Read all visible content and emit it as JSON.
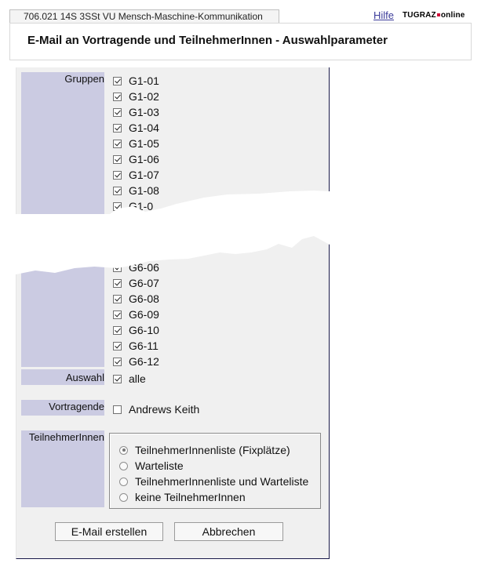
{
  "header": {
    "course": "706.021 14S 3SSt VU Mensch-Maschine-Kommunikation",
    "help": "Hilfe",
    "logo_left": "TUGRAZ",
    "logo_right": "online",
    "title": "E-Mail an Vortragende und TeilnehmerInnen - Auswahlparameter"
  },
  "groups": {
    "label": "Gruppen",
    "top_items": [
      {
        "label": "G1-01",
        "checked": true
      },
      {
        "label": "G1-02",
        "checked": true
      },
      {
        "label": "G1-03",
        "checked": true
      },
      {
        "label": "G1-04",
        "checked": true
      },
      {
        "label": "G1-05",
        "checked": true
      },
      {
        "label": "G1-06",
        "checked": true
      },
      {
        "label": "G1-07",
        "checked": true
      },
      {
        "label": "G1-08",
        "checked": true
      },
      {
        "label": "G1-0",
        "checked": true
      }
    ],
    "bottom_items": [
      {
        "label": "G6-06",
        "checked": true
      },
      {
        "label": "G6-07",
        "checked": true
      },
      {
        "label": "G6-08",
        "checked": true
      },
      {
        "label": "G6-09",
        "checked": true
      },
      {
        "label": "G6-10",
        "checked": true
      },
      {
        "label": "G6-11",
        "checked": true
      },
      {
        "label": "G6-12",
        "checked": true
      }
    ]
  },
  "selection": {
    "label": "Auswahl",
    "option": "alle",
    "checked": true
  },
  "lecturers": {
    "label": "Vortragende",
    "name": "Andrews Keith",
    "checked": false
  },
  "participants": {
    "label": "TeilnehmerInnen",
    "options": [
      {
        "label": "TeilnehmerInnenliste (Fixplätze)",
        "selected": true
      },
      {
        "label": "Warteliste",
        "selected": false
      },
      {
        "label": "TeilnehmerInnenliste und Warteliste",
        "selected": false
      },
      {
        "label": "keine TeilnehmerInnen",
        "selected": false
      }
    ]
  },
  "buttons": {
    "create": "E-Mail erstellen",
    "cancel": "Abbrechen"
  }
}
